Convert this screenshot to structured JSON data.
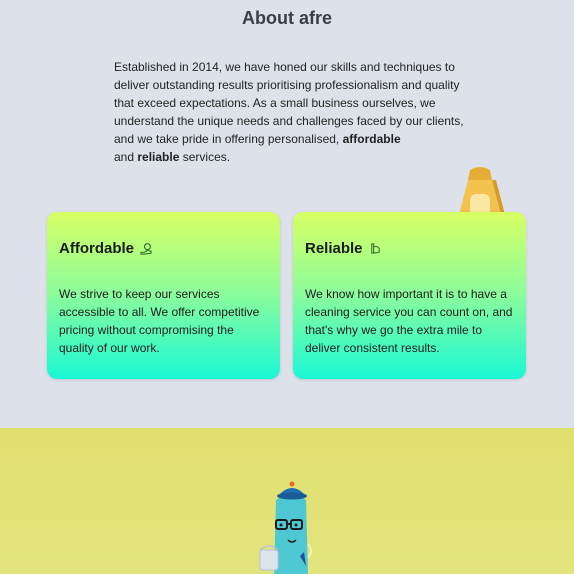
{
  "about": {
    "title": "About afre",
    "paragraph_main": "Established in 2014, we have honed our skills and techniques to deliver outstanding results prioritising professionalism and quality that exceed expectations. As a small business ourselves, we understand the unique needs and challenges faced by our clients, and we take pride in offering personalised,",
    "paragraph_bold1": "affordable",
    "paragraph_and": "and",
    "paragraph_bold2": "reliable",
    "paragraph_end": "services."
  },
  "cards": [
    {
      "title": "Affordable",
      "icon": "money-hand-icon",
      "text": "We strive to keep our services accessible to all. We offer competitive pricing without compromising the quality of our work."
    },
    {
      "title": "Reliable",
      "icon": "handshake-icon",
      "text": "We know how important it is to have a cleaning service you can count on, and that's why we go the extra mile to deliver consistent results."
    }
  ],
  "colors": {
    "page_bg": "#dde1ea",
    "card_gradient_top": "#d8ff63",
    "card_gradient_bottom": "#1af7d5",
    "bottom_band": "#dfe06e",
    "sign_color": "#f3c24f"
  },
  "decorations": {
    "sign_icon": "wet-floor-sign-icon",
    "mascot_icon": "cleaner-mascot-icon"
  }
}
